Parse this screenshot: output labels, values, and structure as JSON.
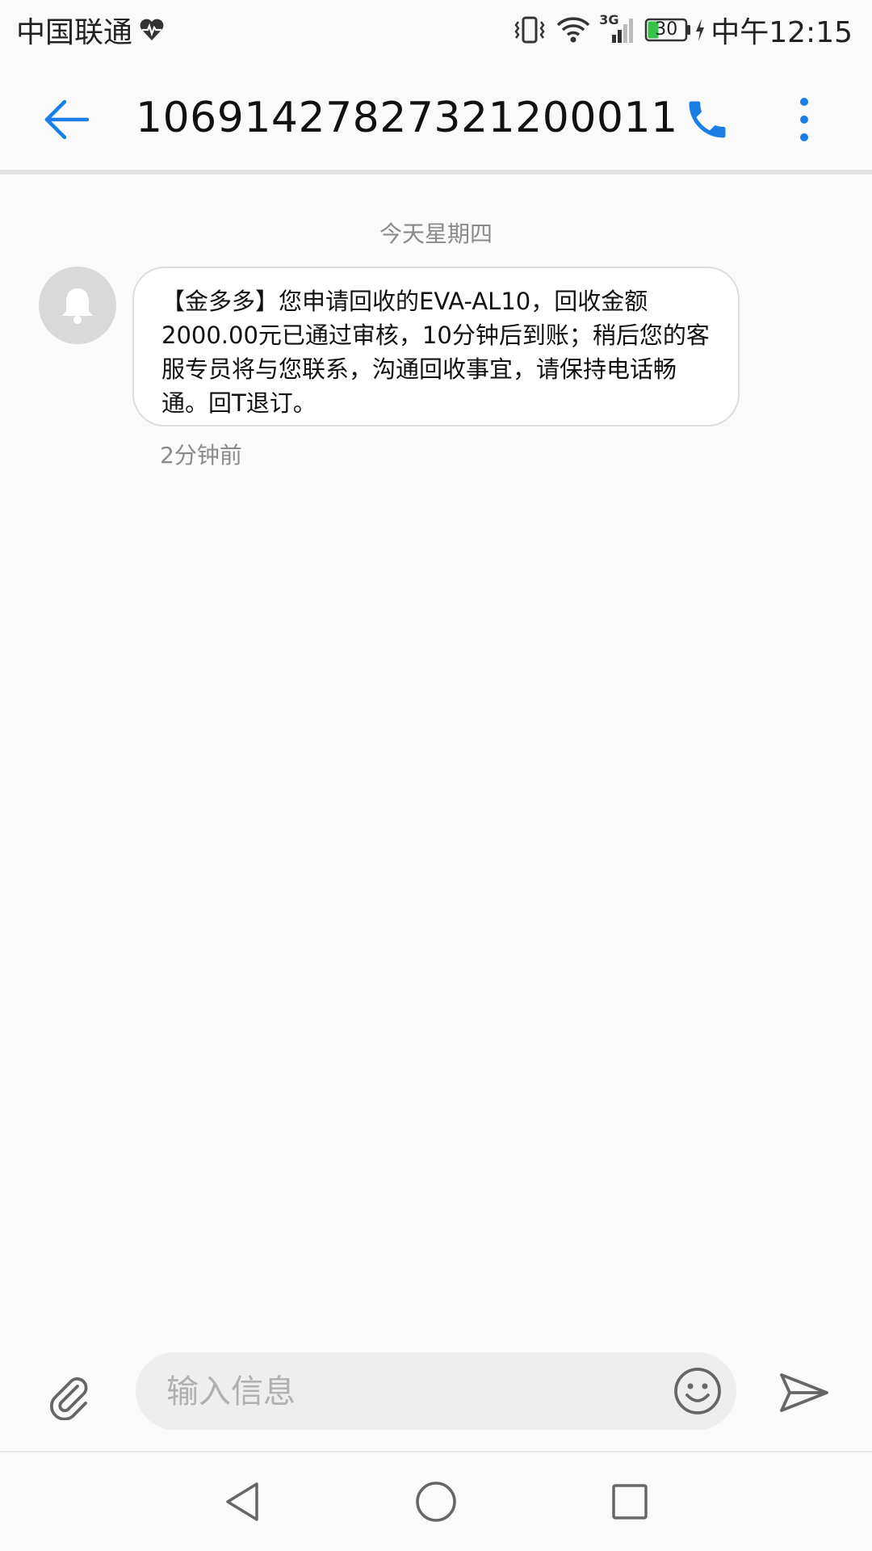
{
  "status_bar": {
    "carrier": "中国联通",
    "network_type": "3G",
    "battery_level": "30",
    "clock": "中午12:15",
    "icons": [
      "heart-rate-icon",
      "vibrate-icon",
      "wifi-icon",
      "signal-icon",
      "battery-icon",
      "charging-icon"
    ]
  },
  "app_bar": {
    "title": "1069142782732120001 1",
    "title_display": "10691427827321200011",
    "icons": [
      "back-arrow-icon",
      "phone-icon",
      "more-vert-icon"
    ]
  },
  "conversation": {
    "date_divider": "今天星期四",
    "messages": [
      {
        "text": "【金多多】您申请回收的EVA-AL10，回收金额2000.00元已通过审核，10分钟后到账；稍后您的客服专员将与您联系，沟通回收事宜，请保持电话畅通。回T退订。",
        "time": "2分钟前",
        "avatar_icon": "bell-icon"
      }
    ]
  },
  "compose": {
    "value": "",
    "placeholder": "输入信息",
    "icons": [
      "paperclip-icon",
      "emoji-icon",
      "send-icon"
    ]
  },
  "nav_bar": {
    "icons": [
      "nav-back-icon",
      "nav-home-icon",
      "nav-recents-icon"
    ]
  },
  "colors": {
    "accent": "#1a7ee6",
    "background": "#fafafa",
    "bubble": "#ffffff",
    "bubble_border": "#dcdcdc",
    "secondary_text": "#8a8a8a",
    "battery_green": "#35c24a"
  }
}
